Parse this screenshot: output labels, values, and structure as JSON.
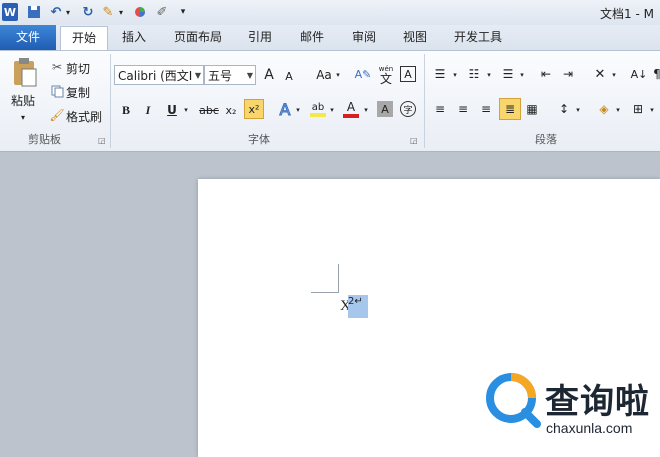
{
  "window": {
    "title": "文档1 - M"
  },
  "tabs": {
    "file": "文件",
    "home": "开始",
    "insert": "插入",
    "layout": "页面布局",
    "references": "引用",
    "mailings": "邮件",
    "review": "审阅",
    "view": "视图",
    "developer": "开发工具"
  },
  "clipboard": {
    "paste": "粘贴",
    "cut": "剪切",
    "copy": "复制",
    "format_painter": "格式刷",
    "label": "剪贴板"
  },
  "font": {
    "name": "Calibri (西文I",
    "size": "五号",
    "label": "字体",
    "grow": "A",
    "shrink": "A",
    "change_case": "Aa",
    "bold": "B",
    "italic": "I",
    "underline": "U",
    "strike": "abc",
    "subscript": "x₂",
    "superscript": "x²",
    "text_effect": "A",
    "highlight": "ab",
    "font_color": "A",
    "shading": "A",
    "enclose": "字",
    "phonetic": "wén",
    "phonetic_char": "文",
    "border": "A"
  },
  "paragraph": {
    "label": "段落"
  },
  "document": {
    "base": "X",
    "superscript": "2↵"
  },
  "watermark": {
    "name": "查询啦",
    "url": "chaxunla.com"
  },
  "colors": {
    "file_tab": "#2a6cc3",
    "highlight_yellow": "#f5e84a",
    "font_red": "#d62020",
    "selection": "#a6c7ec"
  }
}
